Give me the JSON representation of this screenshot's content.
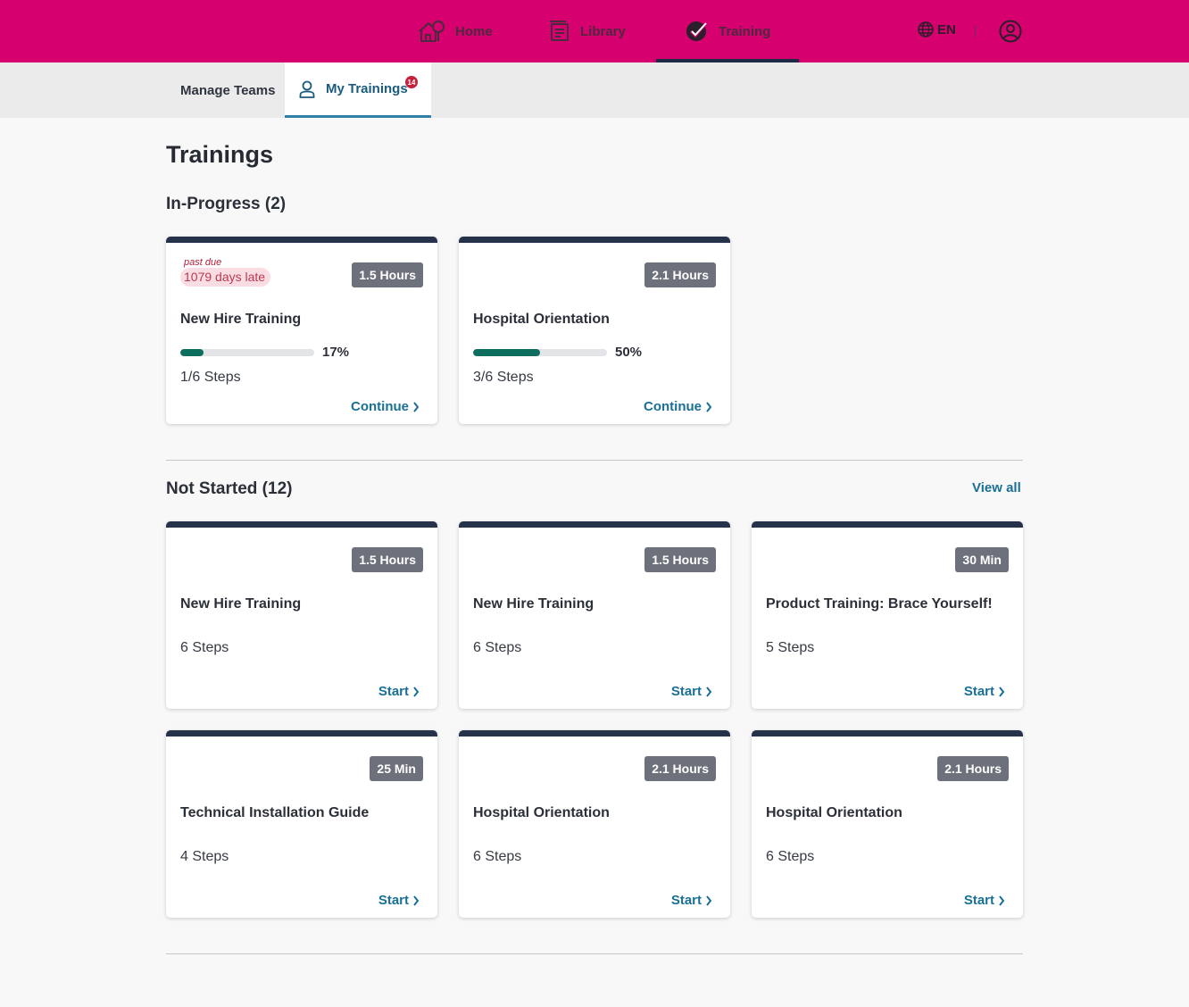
{
  "nav": {
    "home": "Home",
    "library": "Library",
    "training": "Training",
    "language": "EN"
  },
  "subnav": {
    "manage_teams": "Manage Teams",
    "my_trainings": "My Trainings",
    "my_trainings_badge": "14"
  },
  "page": {
    "title": "Trainings"
  },
  "in_progress": {
    "heading": "In-Progress (2)",
    "cards": [
      {
        "duration": "1.5 Hours",
        "title": "New Hire Training",
        "overdue_label": "past due",
        "overdue_text": "1079 days late",
        "progress_pct": 17,
        "progress_label": "17%",
        "steps": "1/6 Steps",
        "action": "Continue"
      },
      {
        "duration": "2.1 Hours",
        "title": "Hospital Orientation",
        "progress_pct": 50,
        "progress_label": "50%",
        "steps": "3/6 Steps",
        "action": "Continue"
      }
    ]
  },
  "not_started": {
    "heading": "Not Started (12)",
    "view_all": "View all",
    "cards": [
      {
        "duration": "1.5 Hours",
        "title": "New Hire Training",
        "steps": "6 Steps",
        "action": "Start"
      },
      {
        "duration": "1.5 Hours",
        "title": "New Hire Training",
        "steps": "6 Steps",
        "action": "Start"
      },
      {
        "duration": "30 Min",
        "title": "Product Training: Brace Yourself!",
        "steps": "5 Steps",
        "action": "Start"
      },
      {
        "duration": "25 Min",
        "title": "Technical Installation Guide",
        "steps": "4 Steps",
        "action": "Start"
      },
      {
        "duration": "2.1 Hours",
        "title": "Hospital Orientation",
        "steps": "6 Steps",
        "action": "Start"
      },
      {
        "duration": "2.1 Hours",
        "title": "Hospital Orientation",
        "steps": "6 Steps",
        "action": "Start"
      }
    ]
  },
  "colors": {
    "brand": "#d6006e",
    "card_top": "#26324a",
    "progress": "#0e6e5e",
    "link": "#1a6f96",
    "late": "#b0203a"
  }
}
